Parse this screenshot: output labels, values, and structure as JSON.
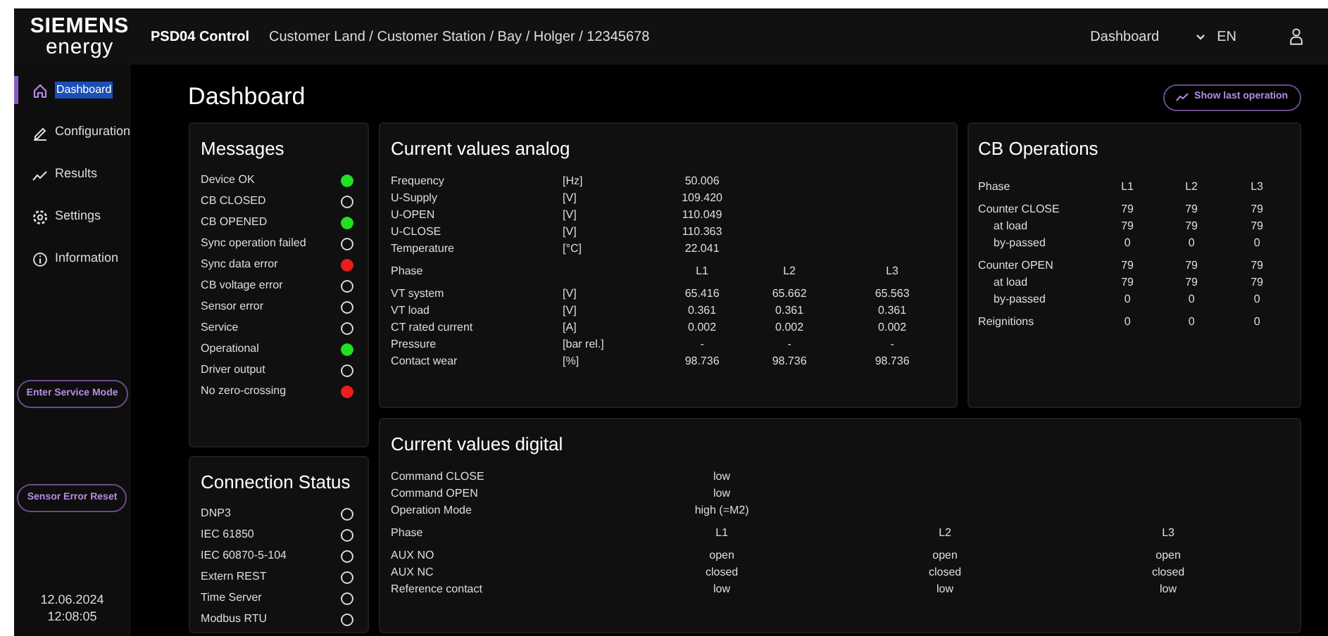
{
  "header": {
    "logo_top": "SIEMENS",
    "logo_bottom": "energy",
    "app_name": "PSD04 Control",
    "breadcrumb": "Customer Land / Customer Station / Bay / Holger / 12345678",
    "page": "Dashboard",
    "language": "EN"
  },
  "sidebar": {
    "items": [
      {
        "label": "Dashboard",
        "selected": true
      },
      {
        "label": "Configuration",
        "selected": false
      },
      {
        "label": "Results",
        "selected": false
      },
      {
        "label": "Settings",
        "selected": false
      },
      {
        "label": "Information",
        "selected": false
      }
    ],
    "buttons": [
      "Enter Service Mode",
      "Sensor Error Reset"
    ],
    "date": "12.06.2024",
    "time": "12:08:05"
  },
  "page_title": "Dashboard",
  "show_last_operation": "Show last operation",
  "messages": {
    "title": "Messages",
    "items": [
      {
        "label": "Device OK",
        "on": true,
        "color": "#22e022"
      },
      {
        "label": "CB CLOSED",
        "on": false
      },
      {
        "label": "CB OPENED",
        "on": true,
        "color": "#22e022"
      },
      {
        "label": "Sync operation failed",
        "on": false
      },
      {
        "label": "Sync data error",
        "on": true,
        "color": "#ee1c1c"
      },
      {
        "label": "CB voltage error",
        "on": false
      },
      {
        "label": "Sensor error",
        "on": false
      },
      {
        "label": "Service",
        "on": false
      },
      {
        "label": "Operational",
        "on": true,
        "color": "#22e022"
      },
      {
        "label": "Driver output",
        "on": false
      },
      {
        "label": "No zero-crossing",
        "on": true,
        "color": "#ee1c1c"
      }
    ]
  },
  "connection": {
    "title": "Connection Status",
    "items": [
      {
        "label": "DNP3",
        "on": false
      },
      {
        "label": "IEC 61850",
        "on": false
      },
      {
        "label": "IEC 60870-5-104",
        "on": false
      },
      {
        "label": "Extern REST",
        "on": false
      },
      {
        "label": "Time Server",
        "on": false
      },
      {
        "label": "Modbus RTU",
        "on": false
      }
    ]
  },
  "analog": {
    "title": "Current values analog",
    "rows": [
      {
        "kind": "value",
        "label": "Frequency",
        "unit": "[Hz]",
        "values": [
          "50.006"
        ]
      },
      {
        "kind": "value",
        "label": "U-Supply",
        "unit": "[V]",
        "values": [
          "109.420"
        ]
      },
      {
        "kind": "value",
        "label": "U-OPEN",
        "unit": "[V]",
        "values": [
          "110.049"
        ]
      },
      {
        "kind": "value",
        "label": "U-CLOSE",
        "unit": "[V]",
        "values": [
          "110.363"
        ]
      },
      {
        "kind": "value",
        "label": "Temperature",
        "unit": "[°C]",
        "values": [
          "22.041"
        ]
      },
      {
        "kind": "header",
        "label": "Phase",
        "values": [
          "L1",
          "L2",
          "L3"
        ]
      },
      {
        "kind": "value",
        "label": "VT system",
        "unit": "[V]",
        "values": [
          "65.416",
          "65.662",
          "65.563"
        ]
      },
      {
        "kind": "value",
        "label": "VT load",
        "unit": "[V]",
        "values": [
          "0.361",
          "0.361",
          "0.361"
        ]
      },
      {
        "kind": "value",
        "label": "CT rated current",
        "unit": "[A]",
        "values": [
          "0.002",
          "0.002",
          "0.002"
        ]
      },
      {
        "kind": "value",
        "label": "Pressure",
        "unit": "[bar rel.]",
        "values": [
          "-",
          "-",
          "-"
        ]
      },
      {
        "kind": "value",
        "label": "Contact wear",
        "unit": "[%]",
        "values": [
          "98.736",
          "98.736",
          "98.736"
        ]
      }
    ]
  },
  "cb_operations": {
    "title": "CB Operations",
    "rows": [
      {
        "kind": "header",
        "label": "Phase",
        "values": [
          "L1",
          "L2",
          "L3"
        ]
      },
      {
        "kind": "main",
        "label": "Counter CLOSE",
        "values": [
          "79",
          "79",
          "79"
        ]
      },
      {
        "kind": "sub",
        "label": "at load",
        "values": [
          "79",
          "79",
          "79"
        ]
      },
      {
        "kind": "sub",
        "label": "by-passed",
        "values": [
          "0",
          "0",
          "0"
        ]
      },
      {
        "kind": "main",
        "label": "Counter OPEN",
        "values": [
          "79",
          "79",
          "79"
        ]
      },
      {
        "kind": "sub",
        "label": "at load",
        "values": [
          "79",
          "79",
          "79"
        ]
      },
      {
        "kind": "sub",
        "label": "by-passed",
        "values": [
          "0",
          "0",
          "0"
        ]
      },
      {
        "kind": "main",
        "label": "Reignitions",
        "values": [
          "0",
          "0",
          "0"
        ]
      }
    ]
  },
  "digital": {
    "title": "Current values digital",
    "rows": [
      {
        "kind": "value",
        "label": "Command CLOSE",
        "values": [
          "low"
        ]
      },
      {
        "kind": "value",
        "label": "Command OPEN",
        "values": [
          "low"
        ]
      },
      {
        "kind": "value",
        "label": "Operation Mode",
        "values": [
          "high (=M2)"
        ]
      },
      {
        "kind": "header",
        "label": "Phase",
        "values": [
          "L1",
          "L2",
          "L3"
        ]
      },
      {
        "kind": "value",
        "label": "AUX NO",
        "values": [
          "open",
          "open",
          "open"
        ]
      },
      {
        "kind": "value",
        "label": "AUX NC",
        "values": [
          "closed",
          "closed",
          "closed"
        ]
      },
      {
        "kind": "value",
        "label": "Reference contact",
        "values": [
          "low",
          "low",
          "low"
        ]
      }
    ]
  }
}
